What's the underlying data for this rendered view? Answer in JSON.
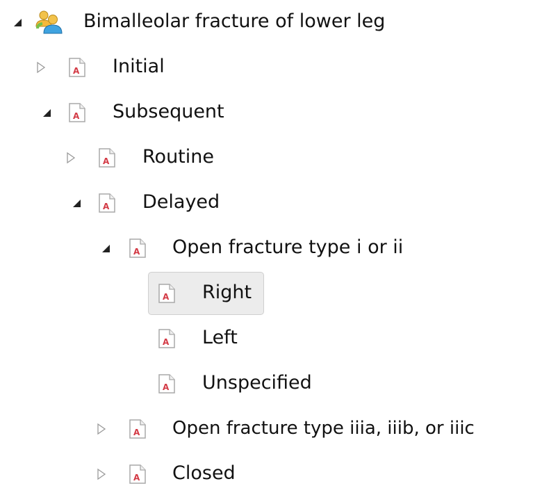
{
  "tree": {
    "root": {
      "label": "Bimalleolar fracture of lower leg",
      "icon": "user-group-icon",
      "state": "expanded"
    },
    "items": [
      {
        "label": "Initial",
        "icon": "document-a-icon",
        "state": "collapsed"
      },
      {
        "label": "Subsequent",
        "icon": "document-a-icon",
        "state": "expanded"
      },
      {
        "label": "Routine",
        "icon": "document-a-icon",
        "state": "collapsed"
      },
      {
        "label": "Delayed",
        "icon": "document-a-icon",
        "state": "expanded"
      },
      {
        "label": "Open fracture type i or ii",
        "icon": "document-a-icon",
        "state": "expanded"
      },
      {
        "label": "Right",
        "icon": "document-a-icon",
        "state": "leaf",
        "selected": true
      },
      {
        "label": "Left",
        "icon": "document-a-icon",
        "state": "leaf"
      },
      {
        "label": "Unspecified",
        "icon": "document-a-icon",
        "state": "leaf"
      },
      {
        "label": "Open fracture type iiia, iiib, or iiic",
        "icon": "document-a-icon",
        "state": "collapsed"
      },
      {
        "label": "Closed",
        "icon": "document-a-icon",
        "state": "collapsed"
      }
    ]
  },
  "colors": {
    "selection_background": "#ececec",
    "selection_border": "#cfcfcf",
    "document_letter": "#d33a45",
    "expander_filled": "#222222",
    "expander_outline": "#9a9a9a"
  }
}
